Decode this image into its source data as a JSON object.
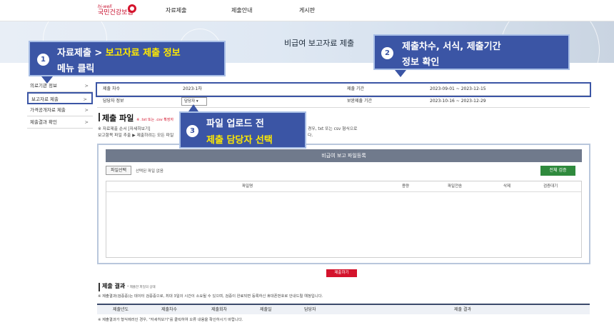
{
  "header": {
    "logo_small": "hi-well",
    "logo_main": "국민건강보험",
    "nav": [
      "자료제출",
      "제출안내",
      "게시판"
    ]
  },
  "banner": {
    "title": "비급여 보고자료 제출"
  },
  "callouts": [
    {
      "num": "1",
      "line1_pre": "자료제출 > ",
      "line1_hl": "보고자료 제출 정보",
      "line2": "메뉴 클릭"
    },
    {
      "num": "2",
      "line1": "제출차수, 서식, 제출기간",
      "line2": "정보 확인"
    },
    {
      "num": "3",
      "line1": "파일 업로드 전",
      "line2": "제출 담당자 선택"
    }
  ],
  "sidebar": {
    "items": [
      {
        "label": "의료기관 정보"
      },
      {
        "label": "보고자료 제출"
      },
      {
        "label": "가격공개자료 제출"
      },
      {
        "label": "제출결과 확인"
      }
    ]
  },
  "info": {
    "rows": [
      {
        "l1": "제출 차수",
        "v1": "2023-1차",
        "l2": "제출 기간",
        "v2": "2023-09-01 ~ 2023-12-15"
      },
      {
        "l1": "담당자 정보",
        "v1": "담당자 ▾",
        "l2": "보완제출 기간",
        "v2": "2023-10-16 ~ 2023-12-29"
      }
    ]
  },
  "file_section": {
    "title": "제출 파일",
    "note": "※ .txt 또는 .csv 확장자",
    "desc1": "※ 자료제출 순서 [자세히보기]",
    "desc1_tail": "경우, txt 또는 csv 형식으로",
    "desc2": "보고항목 파일 추출 ▶ 제출하려는 모든 파일",
    "desc2_tail": "다."
  },
  "upload": {
    "header": "비급여 보고 파일등록",
    "file_button": "파일선택",
    "file_status": "선택된 파일 없음",
    "verify_button": "전체 검증",
    "columns": [
      "파일명",
      "용량",
      "파일전송",
      "삭제",
      "검증대기"
    ]
  },
  "submit_button": "제출하기",
  "result_section": {
    "title": "제출 결과",
    "note": "* 제출한 파일의 상태",
    "desc": "※ 제출결과(검증중)는 데이터 검증중으로, 최대 3일의 시간이 소요될 수 있으며, 검증이 완료되면 등록하신 휴대폰번호로 안내드릴 예정입니다.",
    "columns": [
      "제출년도",
      "제출차수",
      "제출회차",
      "제출일",
      "담당자",
      "제출 결과"
    ],
    "footer": "※ 제출결과가 형식에러인 경우, \"자세히보기\"를 클릭하여 오류 내용을 확인하시기 바랍니다."
  },
  "colors": {
    "accent": "#3b55a5",
    "highlight": "#ffe900",
    "brand": "#d4132c",
    "verify": "#2f8a3d"
  }
}
